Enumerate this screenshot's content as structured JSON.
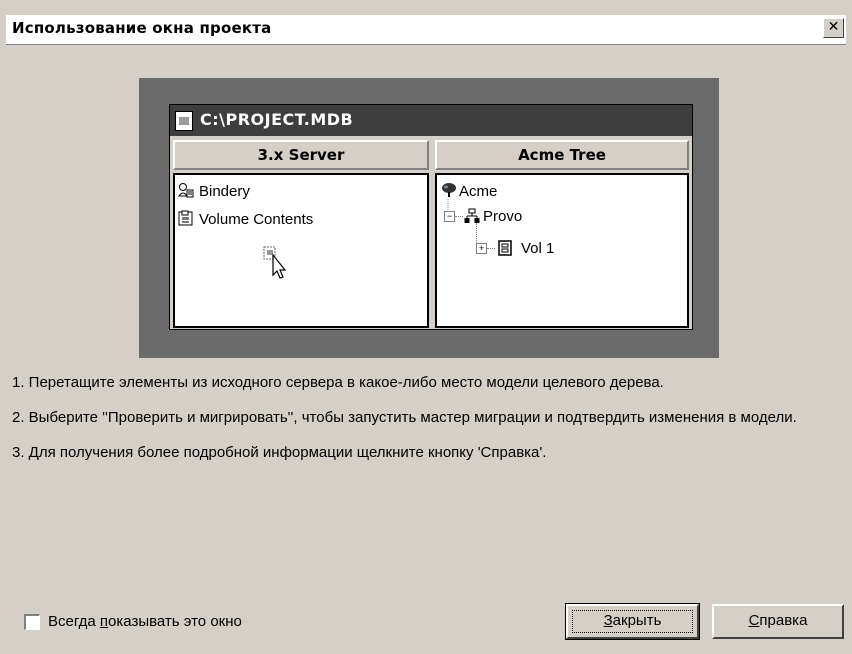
{
  "window": {
    "title": "Использование окна проекта",
    "close_glyph": "✕"
  },
  "illustration": {
    "project_path": "C:\\PROJECT.MDB",
    "left_pane": {
      "header": "3.x Server",
      "items": [
        {
          "icon": "bindery-icon",
          "label": "Bindery"
        },
        {
          "icon": "volume-contents-icon",
          "label": "Volume Contents"
        }
      ],
      "cursor": "drag-cursor-icon"
    },
    "right_pane": {
      "header": "Acme Tree",
      "items": [
        {
          "icon": "tree-icon",
          "label": "Acme"
        },
        {
          "icon": "org-unit-icon",
          "label": "Provo",
          "expander": "−"
        },
        {
          "icon": "volume-icon",
          "label": "Vol 1",
          "expander": "+"
        }
      ]
    }
  },
  "instructions": [
    "1. Перетащите элементы из исходного сервера в какое-либо место модели целевого дерева.",
    "2. Выберите ''Проверить и мигрировать'', чтобы запустить мастер миграции и подтвердить изменения в модели.",
    "3. Для получения более подробной информации щелкните кнопку 'Справка'."
  ],
  "footer": {
    "checkbox_label_pre": "Всегда ",
    "checkbox_label_accel": "п",
    "checkbox_label_post": "оказывать это окно",
    "checkbox_checked": false,
    "close_button_accel": "З",
    "close_button_rest": "акрыть",
    "help_button_accel": "С",
    "help_button_rest": "правка"
  }
}
